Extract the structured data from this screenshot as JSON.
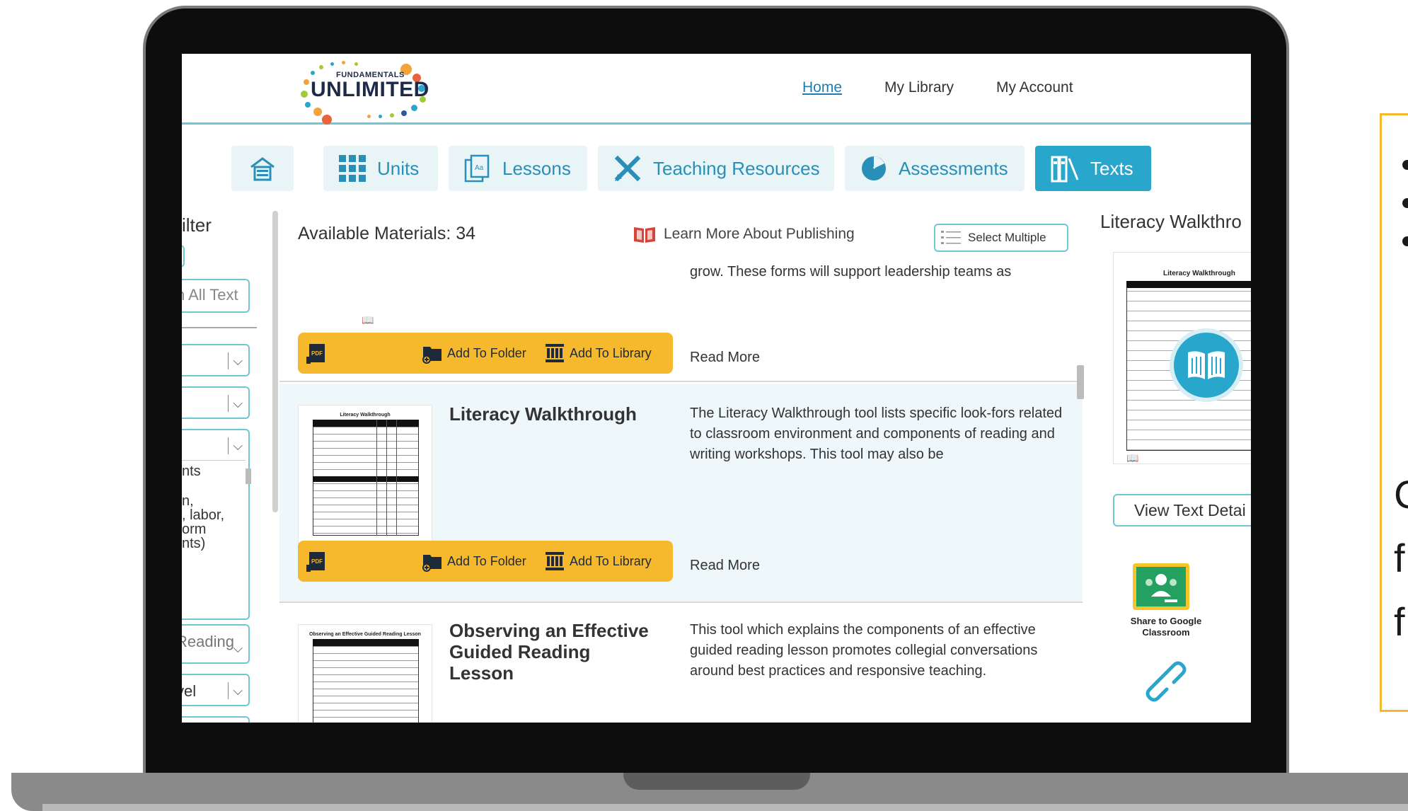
{
  "header": {
    "logo_small": "FUNDAMENTALS",
    "logo_word": "UNLIMITED",
    "nav": [
      "Home",
      "My Library",
      "My Account"
    ]
  },
  "tabs": [
    {
      "label": "",
      "icon": "home-icon"
    },
    {
      "label": "Units",
      "icon": "grid-icon"
    },
    {
      "label": "Lessons",
      "icon": "lesson-icon"
    },
    {
      "label": "Teaching Resources",
      "icon": "pencil-ruler-icon"
    },
    {
      "label": "Assessments",
      "icon": "pie-icon"
    },
    {
      "label": "Texts",
      "icon": "books-icon",
      "active": true
    }
  ],
  "filter": {
    "title": "ilter",
    "search_text": "n All Text",
    "facet_lines": [
      "nts",
      "n,",
      ", labor,",
      "orm",
      "nts)"
    ],
    "reading": "Reading",
    "level": "vel"
  },
  "content": {
    "available": "Available Materials: 34",
    "learn_more": "Learn More About Publishing",
    "select_multiple": "Select Multiple",
    "add_to_folder": "Add To Folder",
    "add_to_library": "Add To Library",
    "read_more": "Read More",
    "items": [
      {
        "title": "",
        "desc": "grow. These forms will support leadership teams as"
      },
      {
        "title": "Literacy Walkthrough",
        "thumb_title": "Literacy Walkthrough",
        "desc": "The Literacy Walkthrough tool lists specific look-fors related to classroom environment and components of reading and writing workshops. This tool may also be"
      },
      {
        "title": "Observing an Effective Guided Reading Lesson",
        "thumb_title": "Observing an Effective Guided Reading Lesson",
        "desc": "This tool which explains the components of an effective guided reading lesson promotes collegial conversations around best practices and responsive teaching."
      }
    ]
  },
  "right_panel": {
    "title": "Literacy Walkthro",
    "thumb_title": "Literacy Walkthrough",
    "view_details": "View Text Detai",
    "share_label": "Share to Google Classroom"
  },
  "callout": {
    "letters": [
      "C",
      "f",
      "f"
    ]
  },
  "colors": {
    "accent": "#29a6cc",
    "action_bar": "#f6b92e",
    "border_teal": "#6fc7d2"
  }
}
